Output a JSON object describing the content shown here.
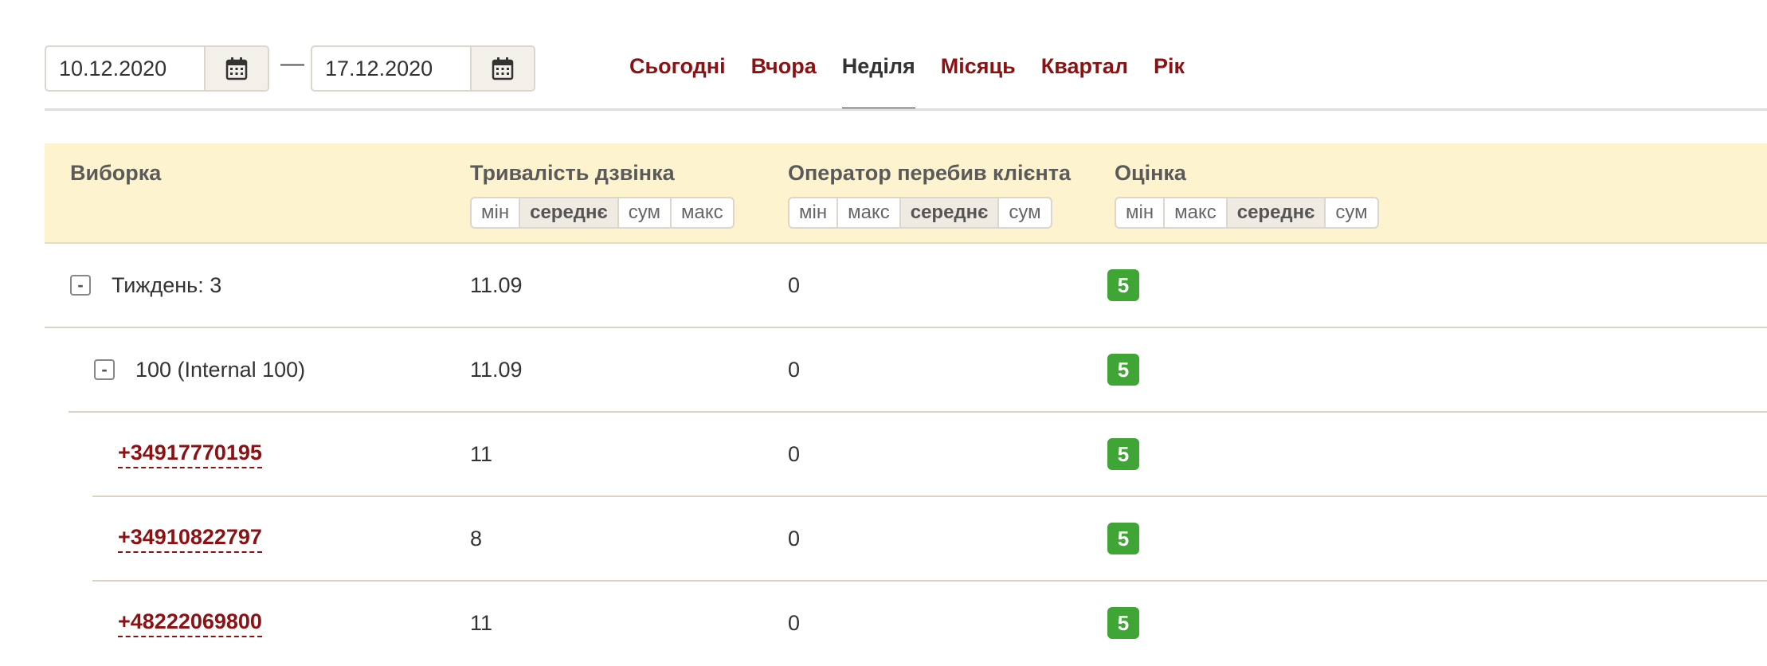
{
  "filters": {
    "date_from": "10.12.2020",
    "date_to": "17.12.2020",
    "separator": "—",
    "periods": [
      "Сьогодні",
      "Вчора",
      "Неділя",
      "Місяць",
      "Квартал",
      "Рік"
    ],
    "active_period": "Неділя"
  },
  "table": {
    "columns": {
      "sample": "Виборка",
      "duration": "Тривалість дзвінка",
      "interrupted": "Оператор перебив клієнта",
      "rating": "Оцінка"
    },
    "aggregators": {
      "duration": [
        "мін",
        "середнє",
        "сум",
        "макс"
      ],
      "duration_active": "середнє",
      "interrupted": [
        "мін",
        "макс",
        "середнє",
        "сум"
      ],
      "interrupted_active": "середнє",
      "rating": [
        "мін",
        "макс",
        "середнє",
        "сум"
      ],
      "rating_active": "середнє"
    },
    "rows": [
      {
        "type": "group",
        "toggle": "-",
        "label": "Тиждень: 3",
        "duration": "11.09",
        "interrupted": "0",
        "rating": "5"
      },
      {
        "type": "subgroup",
        "toggle": "-",
        "label": "100 (Internal 100)",
        "duration": "11.09",
        "interrupted": "0",
        "rating": "5"
      },
      {
        "type": "phone",
        "label": "+34917770195",
        "duration": "11",
        "interrupted": "0",
        "rating": "5"
      },
      {
        "type": "phone",
        "label": "+34910822797",
        "duration": "8",
        "interrupted": "0",
        "rating": "5"
      },
      {
        "type": "phone",
        "label": "+48222069800",
        "duration": "11",
        "interrupted": "0",
        "rating": "5"
      }
    ]
  },
  "colors": {
    "accent": "#8c1113",
    "header_bg": "#fdf3cf",
    "badge_green": "#3fa535"
  },
  "icons": {
    "calendar": "calendar-icon"
  }
}
